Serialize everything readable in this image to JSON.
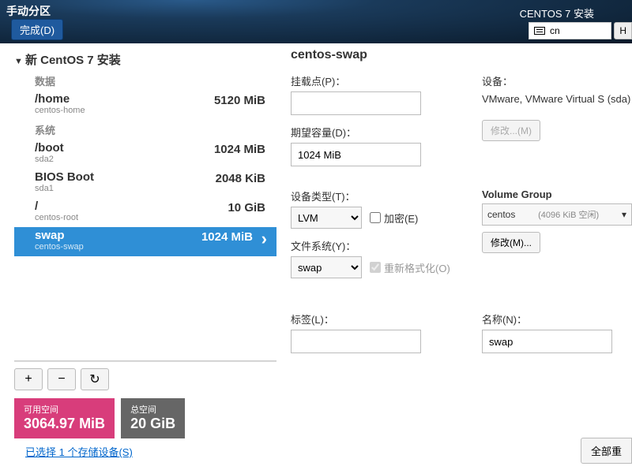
{
  "header": {
    "title": "手动分区",
    "subtitle": "CENTOS 7 安装",
    "done": "完成(D)",
    "lang": "cn",
    "help": "H"
  },
  "tree": {
    "root": "新 CentOS 7 安装",
    "cat_data": "数据",
    "cat_sys": "系统",
    "parts": {
      "home": {
        "name": "/home",
        "desc": "centos-home",
        "size": "5120 MiB"
      },
      "boot": {
        "name": "/boot",
        "desc": "sda2",
        "size": "1024 MiB"
      },
      "bios": {
        "name": "BIOS Boot",
        "desc": "sda1",
        "size": "2048 KiB"
      },
      "root": {
        "name": "/",
        "desc": "centos-root",
        "size": "10 GiB"
      },
      "swap": {
        "name": "swap",
        "desc": "centos-swap",
        "size": "1024 MiB"
      }
    }
  },
  "toolbar": {
    "add": "+",
    "remove": "−"
  },
  "space": {
    "avail_lbl": "可用空间",
    "avail_val": "3064.97 MiB",
    "total_lbl": "总空间",
    "total_val": "20 GiB"
  },
  "sel_link": "已选择 1 个存储设备(S)",
  "details": {
    "title": "centos-swap",
    "mount_lbl": "挂载点(P)：",
    "mount_val": "",
    "cap_lbl": "期望容量(D)：",
    "cap_val": "1024 MiB",
    "dev_lbl": "设备：",
    "dev_txt": "VMware, VMware Virtual S (sda)",
    "mod_btn": "修改...(M)",
    "dtype_lbl": "设备类型(T)：",
    "dtype_val": "LVM",
    "enc_lbl": "加密(E)",
    "vg_lbl": "Volume Group",
    "vg_name": "centos",
    "vg_free": "(4096 KiB 空闲)",
    "vg_mod": "修改(M)...",
    "fs_lbl": "文件系统(Y)：",
    "fs_val": "swap",
    "refmt_lbl": "重新格式化(O)",
    "label_lbl": "标签(L)：",
    "label_val": "",
    "name_lbl": "名称(N)：",
    "name_val": "swap"
  },
  "reset_btn": "全部重"
}
